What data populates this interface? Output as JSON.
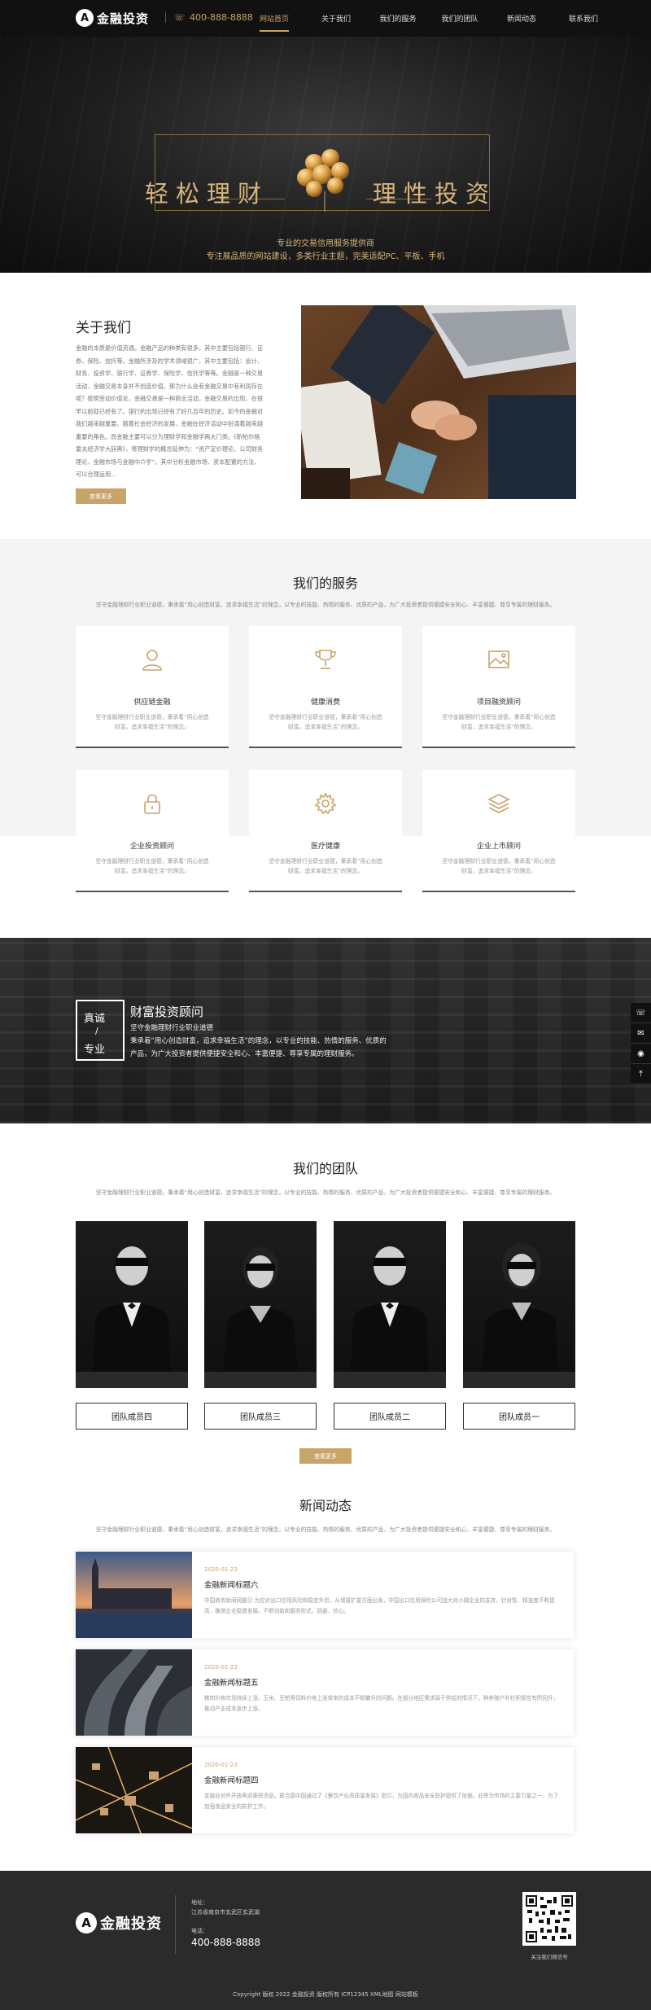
{
  "header": {
    "logo_mark": "A",
    "logo_text": "金融投资",
    "phone": "400-888-8888",
    "phone_icon": "phone-icon",
    "nav": [
      {
        "label": "网站首页",
        "active": true
      },
      {
        "label": "关于我们"
      },
      {
        "label": "我们的服务"
      },
      {
        "label": "我们的团队"
      },
      {
        "label": "新闻动态"
      },
      {
        "label": "联系我们"
      }
    ]
  },
  "banner": {
    "left_text": "轻松理财",
    "right_text": "理性投资",
    "sub1": "专业的交易信用服务提供商",
    "sub2": "专注展品质的网站建设，多类行业主题，完美适配PC、平板、手机",
    "slides": 3,
    "active_slide": 1
  },
  "about": {
    "title": "关于我们",
    "text": "金融的本质是价值流通。金融产品的种类有很多，其中主要包括银行、证券、保险、信托等。金融所涉及的学术领域很广，其中主要包括：会计、财务、投资学、银行学、证券学、保险学、信托学等等。金融是一种交易活动，金融交易本身并不创造价值。那为什么会有金融交易中有利润存在呢？按照劳动价值论，金融交易是一种商业活动，金融交易的出现，在很早以前就已经有了。银行的出现已经有了好几百年的历史。如今的金融对我们越来越重要。随着社会经济的发展，金融在经济活动中扮演着越来越重要的角色。而金融主要可以分为理财学和金融学两大门类。《新帕尔格雷夫经济学大辞典》，将理财学的概念延伸为：“资产定价理论、公司财务理论、金融市场与金融中介学”。其中分析金融市场、资本配置的方法、可以合理运用...",
    "button": "查看更多"
  },
  "services": {
    "title": "我们的服务",
    "desc": "坚守金融理财行业职业道德，秉承着“用心创造财富，追求幸福生活”的理念，以专业的技能、热情的服务、优质的产品，为广大投资者提供便捷安全和心、丰富便捷、尊享专属的理财服务。",
    "items": [
      {
        "icon": "user-icon",
        "title": "供应链金融",
        "desc": "坚守金融理财行业职业道德，秉承着“用心创造财富，追求幸福生活”的理念。"
      },
      {
        "icon": "trophy-icon",
        "title": "健康消费",
        "desc": "坚守金融理财行业职业道德，秉承着“用心创造财富，追求幸福生活”的理念。"
      },
      {
        "icon": "image-icon",
        "title": "项目融资顾问",
        "desc": "坚守金融理财行业职业道德，秉承着“用心创造财富，追求幸福生活”的理念。"
      },
      {
        "icon": "lock-icon",
        "title": "企业投资顾问",
        "desc": "坚守金融理财行业职业道德，秉承着“用心创造财富，追求幸福生活”的理念。"
      },
      {
        "icon": "gear-icon",
        "title": "医疗健康",
        "desc": "坚守金融理财行业职业道德，秉承着“用心创造财富，追求幸福生活”的理念。"
      },
      {
        "icon": "layers-icon",
        "title": "企业上市顾问",
        "desc": "坚守金融理财行业职业道德，秉承着“用心创造财富，追求幸福生活”的理念。"
      }
    ]
  },
  "consult": {
    "badge_1": "真诚",
    "badge_2": "/",
    "badge_3": "专业",
    "title": "财富投资顾问",
    "line1": "坚守金融理财行业职业道德",
    "line2": "秉承着“用心创造财富，追求幸福生活”的理念，以专业的技能、热情的服务、优质的",
    "line3": "产品，为广大投资者提供便捷安全和心、丰富便捷、尊享专属的理财服务。",
    "side_tools": [
      "phone-icon",
      "chat-icon",
      "wechat-icon",
      "top-icon"
    ]
  },
  "team": {
    "title": "我们的团队",
    "desc": "坚守金融理财行业职业道德，秉承着“用心创造财富，追求幸福生活”的理念，以专业的技能、热情的服务、优质的产品，为广大投资者提供便捷安全和心、丰富便捷、尊享专属的理财服务。",
    "members": [
      "团队成员四",
      "团队成员三",
      "团队成员二",
      "团队成员一"
    ],
    "button": "查看更多"
  },
  "news": {
    "title": "新闻动态",
    "desc": "坚守金融理财行业职业道德，秉承着“用心创造财富，追求幸福生活”的理念，以专业的技能、热情的服务、优质的产品，为广大投资者提供便捷安全和心、丰富便捷、尊享专属的理财服务。",
    "items": [
      {
        "date": "2020-01-23",
        "title": "金融新闻标题六",
        "desc": "中国商务新闻网援引 为应对出口信用风险和稳定外贸，从增量扩量方面出发，中国出口信用保险公司加大对小微企业的支持，针对性、精准度不断提高，确保企业稳健发展。不断创新和服务形式，回避、信心。"
      },
      {
        "date": "2020-01-23",
        "title": "金融新闻标题五",
        "desc": "猪肉价格市场持续上涨，玉米、豆粕等饲料价格上涨带来的成本不断攀升的问题。在部分地区需求弱于供给的情况下，种养殖户补栏积极性有所回升，推动产业成本逐步上涨。"
      },
      {
        "date": "2020-01-23",
        "title": "金融新闻标题四",
        "desc": "金融业对外开放再迎重磅消息。联合国中国通过了《餐饮产业高质量发展》指引，为国内食品安全防护提供了依据。此举为市场的主要力量之一，为了加强食品安全的防护工作。"
      }
    ]
  },
  "footer": {
    "logo_text": "金融投资",
    "addr_label": "地址：",
    "addr": "江苏省南京市玄武区玄武湖",
    "tel_label": "电话：",
    "tel": "400-888-8888",
    "qr_caption": "关注我们微信号",
    "copyright": "Copyright 版权 2022 金融投资 版权所有 ICP12345 XML地图 网站模板"
  }
}
